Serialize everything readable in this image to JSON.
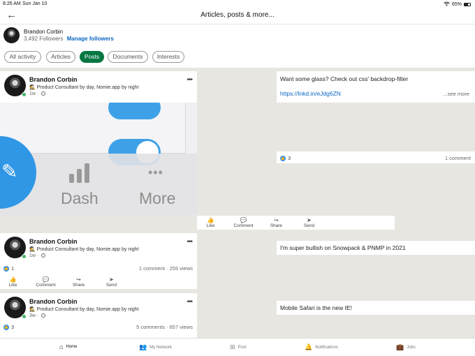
{
  "status": {
    "time": "8:26 AM",
    "date": "Sun Jan 10",
    "battery": "65%"
  },
  "header": {
    "title": "Articles, posts & more..."
  },
  "profile": {
    "name": "Brandon Corbin",
    "followers": "3,492 Followers",
    "manage": "Manage followers"
  },
  "filters": [
    "All activity",
    "Articles",
    "Posts",
    "Documents",
    "Interests"
  ],
  "active_filter": "Posts",
  "author": {
    "name": "Brandon Corbin",
    "headline": "Product Consultant by day, Nomie.app by night",
    "emoji": "🕵"
  },
  "posts": [
    {
      "time": "1w",
      "text": "Want some glass? Check out css' backdrop-filter",
      "link": "https://lnkd.in/eJdg6ZN",
      "see_more": "...see more",
      "likes": "3",
      "comments": "1 comment",
      "image": {
        "dash_label": "Dash",
        "more_label": "More"
      }
    },
    {
      "time": "1w",
      "text": "I'm super bullish on Snowpack & PNMP in 2021",
      "likes": "1",
      "comments": "1 comment",
      "views": "255 views"
    },
    {
      "time": "3w",
      "text": "Mobile Safari is the new IE!",
      "likes": "3",
      "comments": "5 comments",
      "views": "657 views"
    }
  ],
  "actions": {
    "like": "Like",
    "comment": "Comment",
    "share": "Share",
    "send": "Send"
  },
  "tabbar": [
    {
      "label": "Home",
      "icon": "home-icon"
    },
    {
      "label": "My Network",
      "icon": "network-icon"
    },
    {
      "label": "Post",
      "icon": "plus-square-icon"
    },
    {
      "label": "Notifications",
      "icon": "bell-icon"
    },
    {
      "label": "Jobs",
      "icon": "briefcase-icon"
    }
  ],
  "colors": {
    "accent": "#0a66c2",
    "active_chip": "#057642",
    "online": "#45b36b",
    "like": "#378fe9"
  }
}
